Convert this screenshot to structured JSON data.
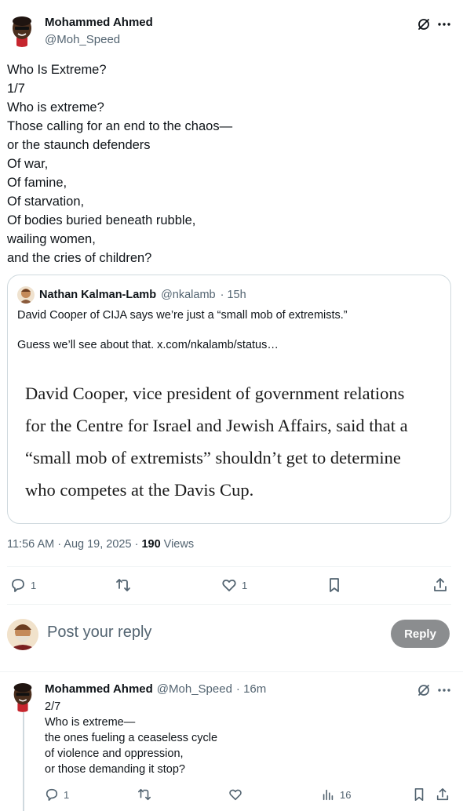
{
  "main_tweet": {
    "author": "Mohammed Ahmed",
    "handle": "@Moh_Speed",
    "text": "Who Is Extreme?\n1/7\nWho is extreme?\nThose calling for an end to the chaos—\nor the staunch defenders\nOf war,\nOf famine,\nOf starvation,\nOf bodies buried beneath rubble,\nwailing women,\nand the cries of children?",
    "time": "11:56 AM · Aug 19, 2025 · ",
    "views_count": "190",
    "views_label": " Views",
    "replies": "1",
    "likes": "1"
  },
  "quote": {
    "author": "Nathan Kalman-Lamb",
    "handle": "@nkalamb",
    "time": "· 15h",
    "line1": "David Cooper of CIJA says we’re just a “small mob of extremists.”",
    "line2": "Guess we’ll see about that.  x.com/nkalamb/status…",
    "excerpt": "David Cooper, vice president of government relations\nfor the Centre for Israel and Jewish Affairs, said that a\n“small mob of extremists” shouldn’t get to determine\nwho competes at the Davis Cup."
  },
  "reply_box": {
    "placeholder": "Post your reply",
    "button": "Reply"
  },
  "second_tweet": {
    "author": "Mohammed Ahmed",
    "handle": "@Moh_Speed",
    "time": "· 16m",
    "text": "2/7\nWho is extreme—\nthe ones fueling a ceaseless cycle\nof violence and oppression,\nor those demanding it stop?",
    "replies": "1",
    "views": "16"
  },
  "icons": [
    "grok-icon",
    "more-icon",
    "reply-icon",
    "retweet-icon",
    "like-icon",
    "bookmark-icon",
    "share-icon",
    "views-icon"
  ]
}
